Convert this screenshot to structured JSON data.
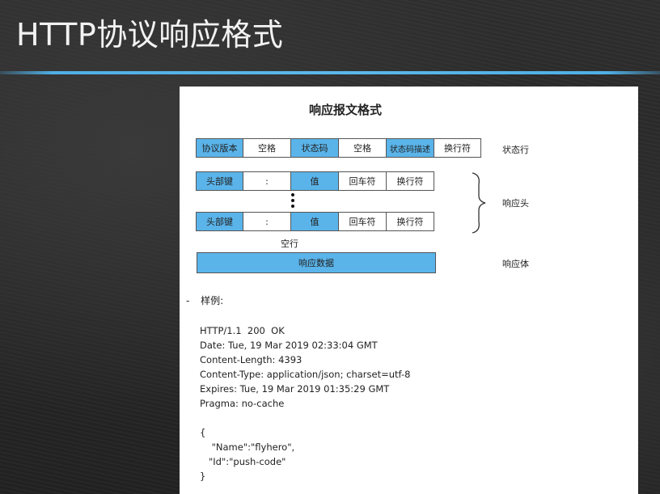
{
  "slide": {
    "title": "HTTP协议响应格式"
  },
  "diagram": {
    "title": "响应报文格式",
    "status_row": [
      "协议版本",
      "空格",
      "状态码",
      "空格",
      "状态码描述",
      "换行符"
    ],
    "status_label": "状态行",
    "header_row_1": [
      "头部键",
      ":",
      "值",
      "回车符",
      "换行符"
    ],
    "header_row_2": [
      "头部键",
      ":",
      "值",
      "回车符",
      "换行符"
    ],
    "header_label": "响应头",
    "empty_line": "空行",
    "body": "响应数据",
    "body_label": "响应体"
  },
  "example": {
    "bullet": "-",
    "heading": "样例:",
    "lines": [
      "HTTP/1.1  200  OK",
      "Date: Tue, 19 Mar 2019 02:33:04 GMT",
      "Content-Length: 4393",
      "Content-Type: application/json; charset=utf-8",
      "Expires: Tue, 19 Mar 2019 01:35:29 GMT",
      "Pragma: no-cache",
      "",
      "{",
      "    \"Name\":\"flyhero\",",
      "   \"Id\":\"push-code\"",
      "}"
    ]
  },
  "colors": {
    "accent": "#5ab4ea",
    "rule": "#4fb0e6",
    "background": "#2a2a2a"
  }
}
